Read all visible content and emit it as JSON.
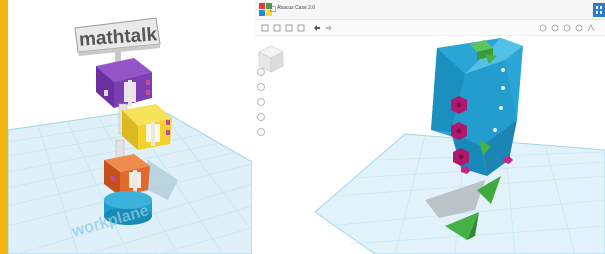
{
  "left_view": {
    "sign_text": "mathtalk",
    "workplane_label": "workplane"
  },
  "right_view": {
    "app_title": "Abacus Case 2.0"
  },
  "colors": {
    "accent_strip": "#f2b411",
    "grid": "#bfe3f4",
    "purple": "#7b3fb1",
    "yellow": "#f3d22c",
    "orange": "#e06a2c",
    "cyan": "#1ea0cf",
    "case_blue": "#2aa6d6",
    "magenta": "#b0186e",
    "green": "#46b146",
    "gray": "#bcc3c8"
  },
  "icons": {
    "toolbar": [
      "copy-icon",
      "paste-icon",
      "duplicate-icon",
      "delete-icon",
      "undo-icon",
      "redo-icon"
    ],
    "toolbar_right": [
      "lightbulb-icon",
      "group-icon",
      "ungroup-icon",
      "align-icon",
      "mirror-icon"
    ]
  }
}
